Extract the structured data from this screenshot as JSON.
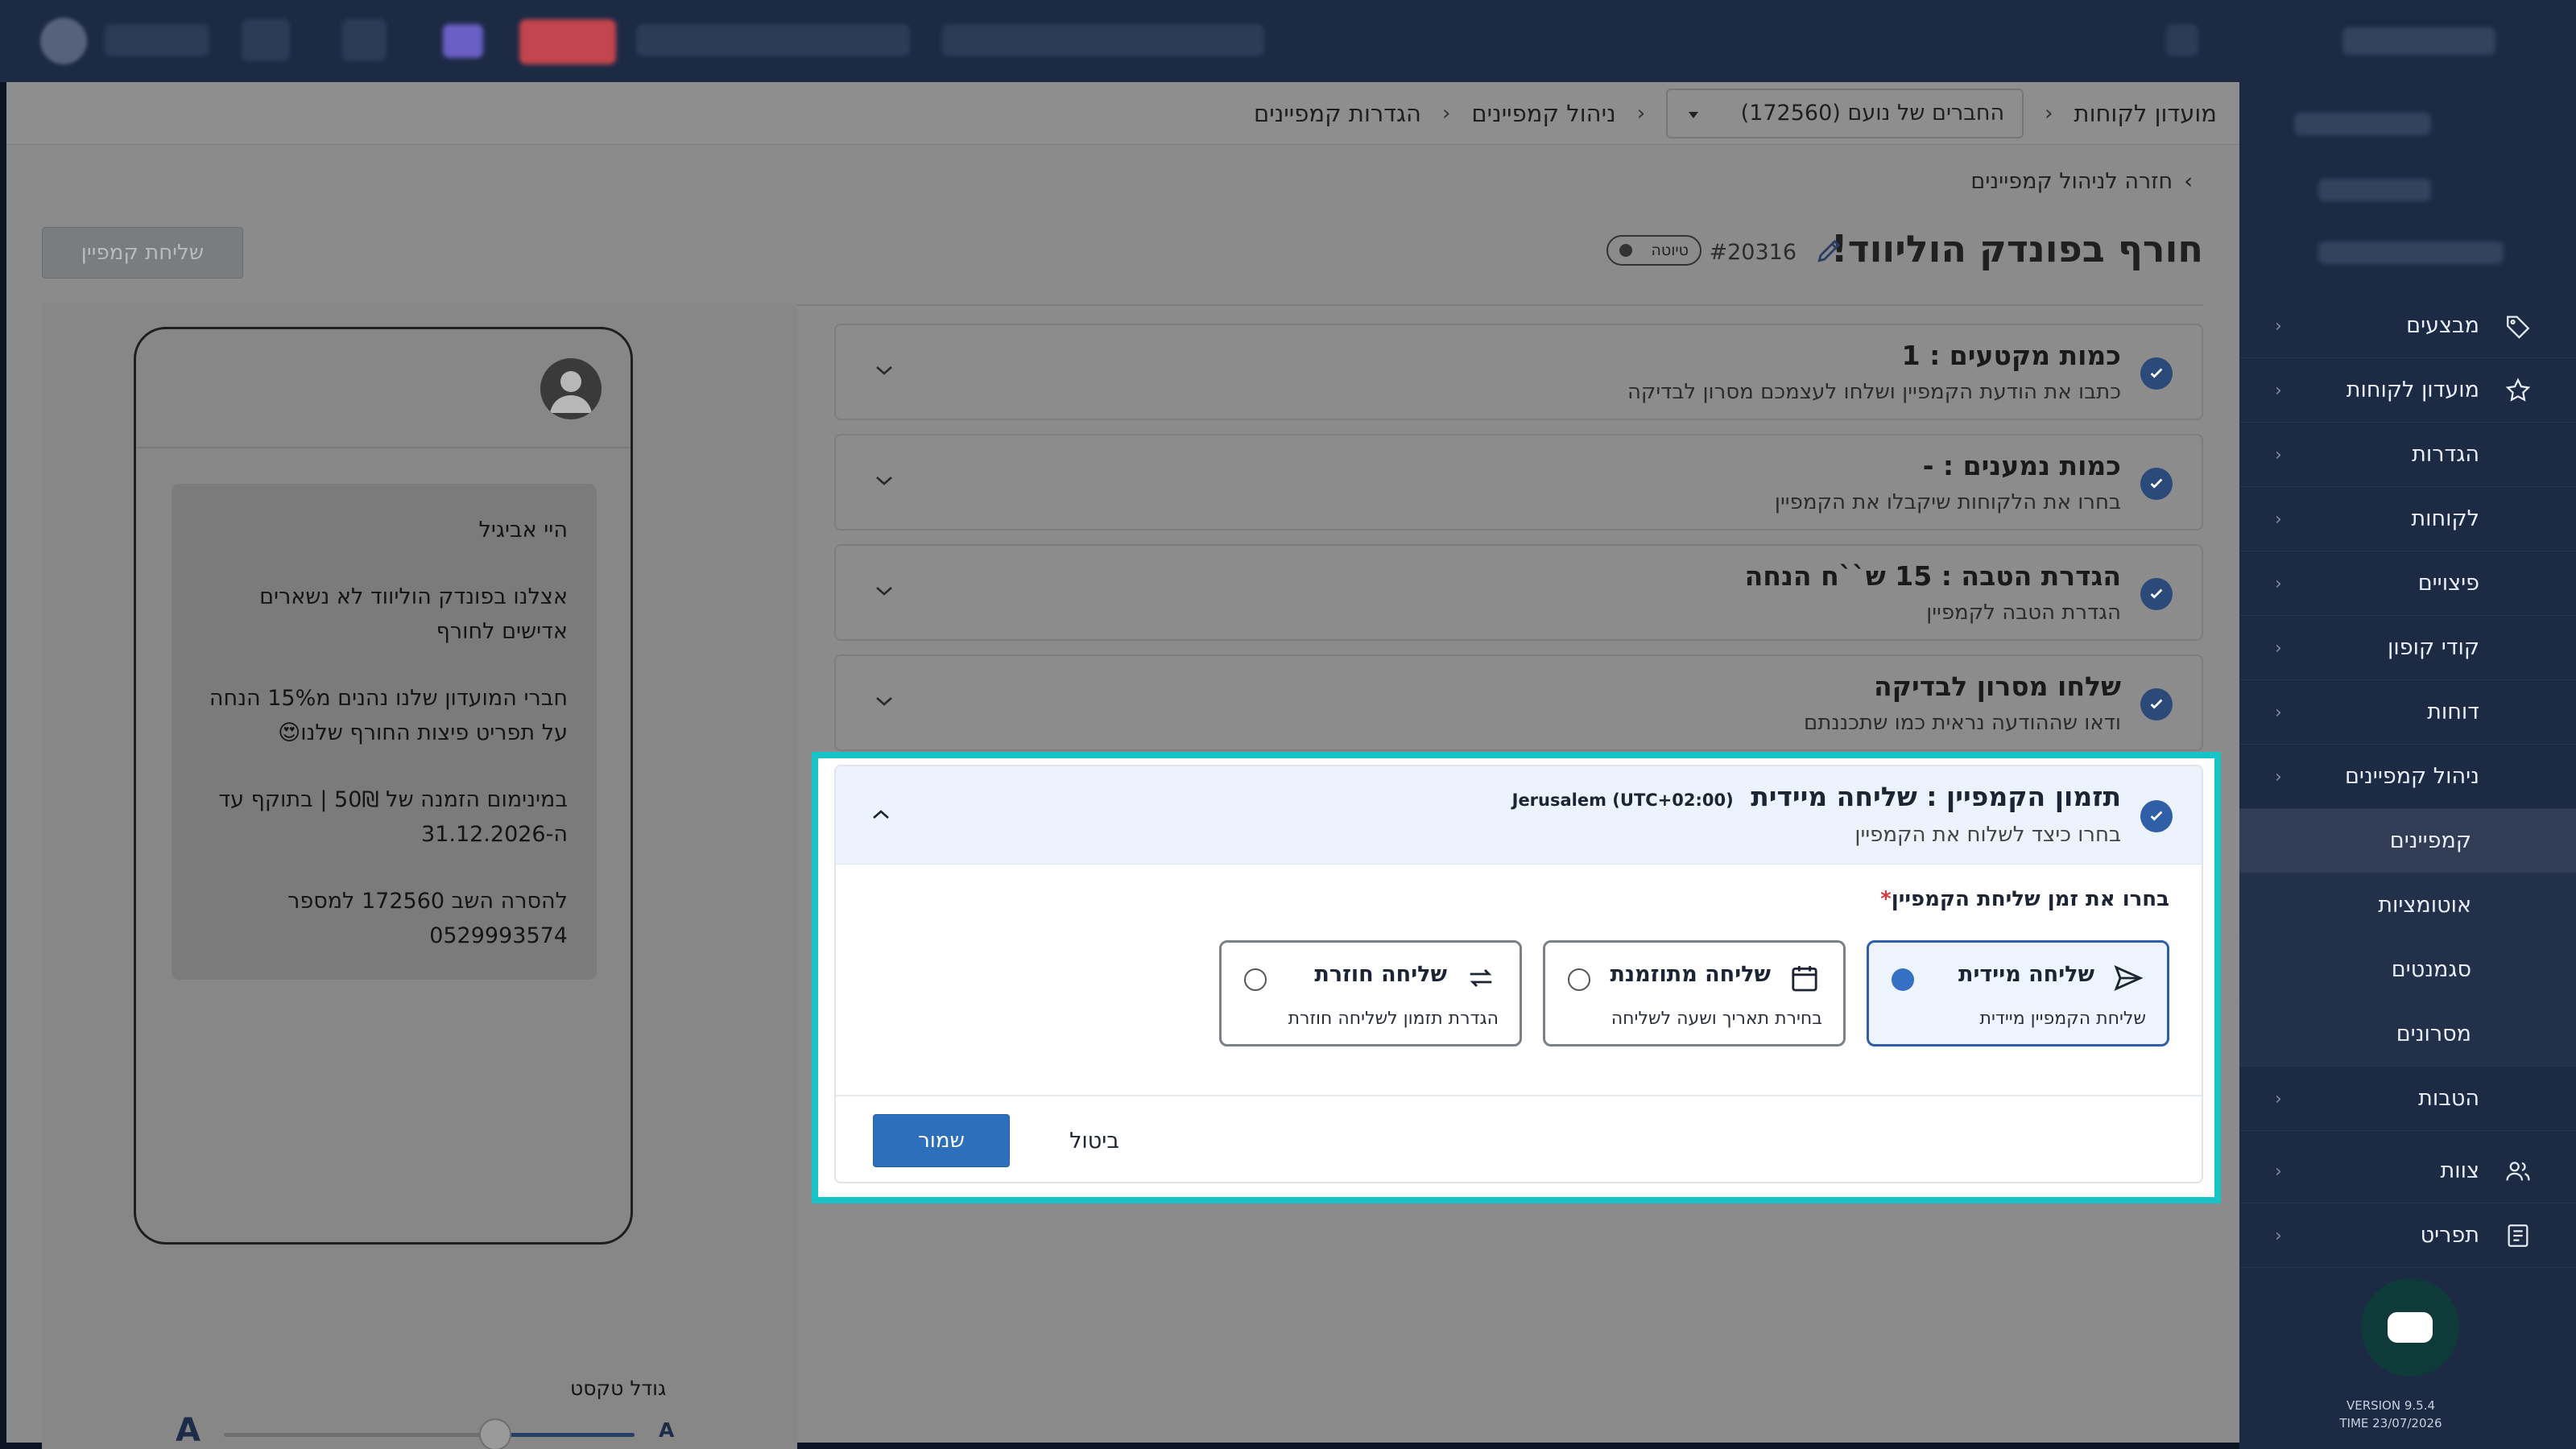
{
  "topbar": {},
  "breadcrumb": {
    "items": [
      "מועדון לקוחות",
      "ניהול קמפיינים",
      "הגדרות קמפיינים"
    ],
    "club_select": "החברים של נועם (172560)"
  },
  "sidebar": {
    "items": [
      {
        "label": "מבצעים",
        "icon": "tag-icon"
      },
      {
        "label": "מועדון לקוחות",
        "icon": "star-icon"
      },
      {
        "label": "הגדרות"
      },
      {
        "label": "לקוחות"
      },
      {
        "label": "פיצויים"
      },
      {
        "label": "קודי קופון"
      },
      {
        "label": "דוחות"
      },
      {
        "label": "ניהול קמפיינים"
      },
      {
        "label": "קמפיינים"
      },
      {
        "label": "אוטומציות"
      },
      {
        "label": "סגמנטים"
      },
      {
        "label": "מסרונים"
      },
      {
        "label": "הטבות"
      },
      {
        "label": "צוות",
        "icon": "users-icon"
      },
      {
        "label": "תפריט",
        "icon": "menu-book-icon"
      }
    ],
    "version_line1": "VERSION 9.5.4",
    "version_line2": "TIME 23/07/2026"
  },
  "page": {
    "back_link": "חזרה לניהול קמפיינים",
    "title": "חורף בפונדק הוליווד!",
    "campaign_id": "#20316",
    "status_badge": "טיוטה",
    "send_button": "שליחת קמפיין"
  },
  "steps": [
    {
      "title": "כמות מקטעים : 1",
      "subtitle": "כתבו את הודעת הקמפיין ושלחו לעצמכם מסרון לבדיקה"
    },
    {
      "title": "כמות נמענים : -",
      "subtitle": "בחרו את הלקוחות שיקבלו את הקמפיין"
    },
    {
      "title": "הגדרת הטבה : 15 ש``ח הנחה",
      "subtitle": "הגדרת הטבה לקמפיין"
    },
    {
      "title": "שלחו מסרון לבדיקה",
      "subtitle": "ודאו שההודעה נראית כמו שתכננתם"
    }
  ],
  "schedule": {
    "title": "תזמון הקמפיין : שליחה מיידית",
    "timezone": "Jerusalem (UTC+02:00)",
    "subtitle": "בחרו כיצד לשלוח את הקמפיין",
    "choose_label": "בחרו את זמן שליחת הקמפיין",
    "required_mark": "*",
    "options": [
      {
        "title": "שליחה מיידית",
        "subtitle": "שליחת הקמפיין מיידית",
        "icon": "send-icon",
        "selected": true
      },
      {
        "title": "שליחה מתוזמנת",
        "subtitle": "בחירת תאריך ושעה לשליחה",
        "icon": "calendar-icon",
        "selected": false
      },
      {
        "title": "שליחה חוזרת",
        "subtitle": "הגדרת תזמון לשליחה חוזרת",
        "icon": "repeat-icon",
        "selected": false
      }
    ],
    "save_button": "שמור",
    "cancel_button": "ביטול"
  },
  "preview": {
    "message_paragraphs": [
      "היי אביגיל",
      "אצלנו בפונדק הוליווד לא נשארים אדישים לחורף",
      "חברי המועדון שלנו נהנים מ15% הנחה על תפריט פיצות החורף שלנו😍",
      "במינימום הזמנה של 50₪ | בתוקף עד ה-31.12.2026",
      "להסרה השב 172560 למספר 0529993574"
    ],
    "text_size_label": "גודל טקסט",
    "text_size_small": "A",
    "text_size_large": "A",
    "text_size_level_percent": 66
  }
}
